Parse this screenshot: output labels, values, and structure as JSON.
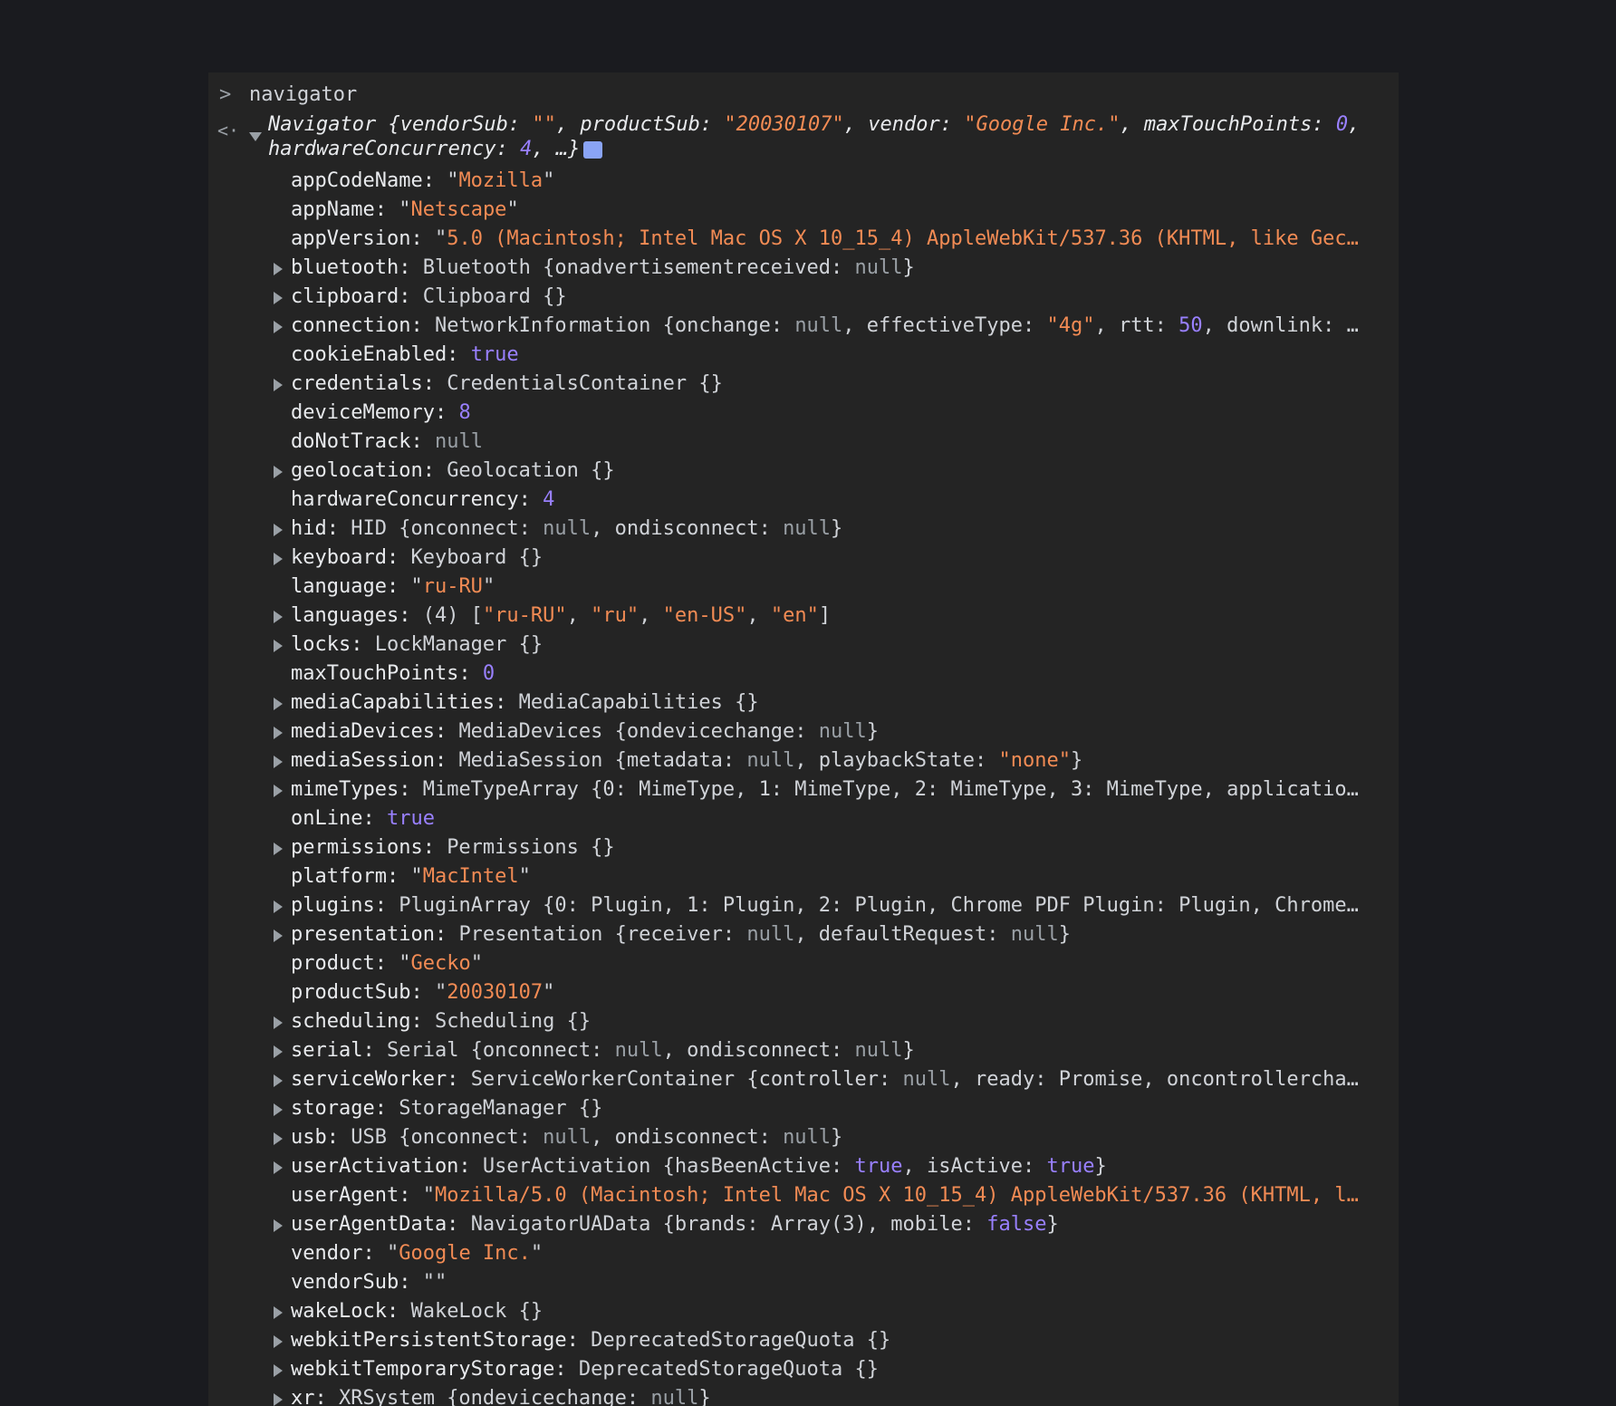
{
  "colors": {
    "page_bg": "#1a1b1f",
    "console_bg": "#242424",
    "string": "#f28b54",
    "number": "#9980ff",
    "null": "#9aa0a6",
    "text": "#e8eaed",
    "badge": "#8aa4f5"
  },
  "input": {
    "prompt_icon": "chevron-right-icon",
    "prompt_glyph": ">",
    "text": "navigator"
  },
  "result": {
    "return_icon": "return-arrow-icon",
    "return_glyph": "<·",
    "summary_line1": [
      {
        "c": "k",
        "v": "Navigator {vendorSub: "
      },
      {
        "c": "s",
        "v": "\"\""
      },
      {
        "c": "k",
        "v": ", productSub: "
      },
      {
        "c": "s",
        "v": "\"20030107\""
      },
      {
        "c": "k",
        "v": ", vendor: "
      },
      {
        "c": "s",
        "v": "\"Google Inc.\""
      },
      {
        "c": "k",
        "v": ", maxTouchPoints: "
      },
      {
        "c": "n",
        "v": "0"
      },
      {
        "c": "k",
        "v": ","
      }
    ],
    "summary_line2": [
      {
        "c": "k",
        "v": "hardwareConcurrency: "
      },
      {
        "c": "n",
        "v": "4"
      },
      {
        "c": "k",
        "v": ", …}"
      }
    ],
    "info_badge": "i"
  },
  "properties": [
    {
      "expandable": false,
      "parts": [
        {
          "c": "k",
          "v": "appCodeName: "
        },
        {
          "c": "t",
          "v": "\""
        },
        {
          "c": "s",
          "v": "Mozilla"
        },
        {
          "c": "t",
          "v": "\""
        }
      ]
    },
    {
      "expandable": false,
      "parts": [
        {
          "c": "k",
          "v": "appName: "
        },
        {
          "c": "t",
          "v": "\""
        },
        {
          "c": "s",
          "v": "Netscape"
        },
        {
          "c": "t",
          "v": "\""
        }
      ]
    },
    {
      "expandable": false,
      "parts": [
        {
          "c": "k",
          "v": "appVersion: "
        },
        {
          "c": "t",
          "v": "\""
        },
        {
          "c": "s",
          "v": "5.0 (Macintosh; Intel Mac OS X 10_15_4) AppleWebKit/537.36 (KHTML, like Gec…"
        }
      ]
    },
    {
      "expandable": true,
      "parts": [
        {
          "c": "k",
          "v": "bluetooth: "
        },
        {
          "c": "t",
          "v": "Bluetooth {onadvertisementreceived: "
        },
        {
          "c": "nl",
          "v": "null"
        },
        {
          "c": "t",
          "v": "}"
        }
      ]
    },
    {
      "expandable": true,
      "parts": [
        {
          "c": "k",
          "v": "clipboard: "
        },
        {
          "c": "t",
          "v": "Clipboard {}"
        }
      ]
    },
    {
      "expandable": true,
      "parts": [
        {
          "c": "k",
          "v": "connection: "
        },
        {
          "c": "t",
          "v": "NetworkInformation {onchange: "
        },
        {
          "c": "nl",
          "v": "null"
        },
        {
          "c": "t",
          "v": ", effectiveType: "
        },
        {
          "c": "s",
          "v": "\"4g\""
        },
        {
          "c": "t",
          "v": ", rtt: "
        },
        {
          "c": "n",
          "v": "50"
        },
        {
          "c": "t",
          "v": ", downlink: …"
        }
      ]
    },
    {
      "expandable": false,
      "parts": [
        {
          "c": "k",
          "v": "cookieEnabled: "
        },
        {
          "c": "b",
          "v": "true"
        }
      ]
    },
    {
      "expandable": true,
      "parts": [
        {
          "c": "k",
          "v": "credentials: "
        },
        {
          "c": "t",
          "v": "CredentialsContainer {}"
        }
      ]
    },
    {
      "expandable": false,
      "parts": [
        {
          "c": "k",
          "v": "deviceMemory: "
        },
        {
          "c": "n",
          "v": "8"
        }
      ]
    },
    {
      "expandable": false,
      "parts": [
        {
          "c": "k",
          "v": "doNotTrack: "
        },
        {
          "c": "nl",
          "v": "null"
        }
      ]
    },
    {
      "expandable": true,
      "parts": [
        {
          "c": "k",
          "v": "geolocation: "
        },
        {
          "c": "t",
          "v": "Geolocation {}"
        }
      ]
    },
    {
      "expandable": false,
      "parts": [
        {
          "c": "k",
          "v": "hardwareConcurrency: "
        },
        {
          "c": "n",
          "v": "4"
        }
      ]
    },
    {
      "expandable": true,
      "parts": [
        {
          "c": "k",
          "v": "hid: "
        },
        {
          "c": "t",
          "v": "HID {onconnect: "
        },
        {
          "c": "nl",
          "v": "null"
        },
        {
          "c": "t",
          "v": ", ondisconnect: "
        },
        {
          "c": "nl",
          "v": "null"
        },
        {
          "c": "t",
          "v": "}"
        }
      ]
    },
    {
      "expandable": true,
      "parts": [
        {
          "c": "k",
          "v": "keyboard: "
        },
        {
          "c": "t",
          "v": "Keyboard {}"
        }
      ]
    },
    {
      "expandable": false,
      "parts": [
        {
          "c": "k",
          "v": "language: "
        },
        {
          "c": "t",
          "v": "\""
        },
        {
          "c": "s",
          "v": "ru-RU"
        },
        {
          "c": "t",
          "v": "\""
        }
      ]
    },
    {
      "expandable": true,
      "parts": [
        {
          "c": "k",
          "v": "languages: "
        },
        {
          "c": "t",
          "v": "(4) ["
        },
        {
          "c": "s",
          "v": "\"ru-RU\""
        },
        {
          "c": "t",
          "v": ", "
        },
        {
          "c": "s",
          "v": "\"ru\""
        },
        {
          "c": "t",
          "v": ", "
        },
        {
          "c": "s",
          "v": "\"en-US\""
        },
        {
          "c": "t",
          "v": ", "
        },
        {
          "c": "s",
          "v": "\"en\""
        },
        {
          "c": "t",
          "v": "]"
        }
      ]
    },
    {
      "expandable": true,
      "parts": [
        {
          "c": "k",
          "v": "locks: "
        },
        {
          "c": "t",
          "v": "LockManager {}"
        }
      ]
    },
    {
      "expandable": false,
      "parts": [
        {
          "c": "k",
          "v": "maxTouchPoints: "
        },
        {
          "c": "n",
          "v": "0"
        }
      ]
    },
    {
      "expandable": true,
      "parts": [
        {
          "c": "k",
          "v": "mediaCapabilities: "
        },
        {
          "c": "t",
          "v": "MediaCapabilities {}"
        }
      ]
    },
    {
      "expandable": true,
      "parts": [
        {
          "c": "k",
          "v": "mediaDevices: "
        },
        {
          "c": "t",
          "v": "MediaDevices {ondevicechange: "
        },
        {
          "c": "nl",
          "v": "null"
        },
        {
          "c": "t",
          "v": "}"
        }
      ]
    },
    {
      "expandable": true,
      "parts": [
        {
          "c": "k",
          "v": "mediaSession: "
        },
        {
          "c": "t",
          "v": "MediaSession {metadata: "
        },
        {
          "c": "nl",
          "v": "null"
        },
        {
          "c": "t",
          "v": ", playbackState: "
        },
        {
          "c": "s",
          "v": "\"none\""
        },
        {
          "c": "t",
          "v": "}"
        }
      ]
    },
    {
      "expandable": true,
      "parts": [
        {
          "c": "k",
          "v": "mimeTypes: "
        },
        {
          "c": "t",
          "v": "MimeTypeArray {0: MimeType, 1: MimeType, 2: MimeType, 3: MimeType, applicatio…"
        }
      ]
    },
    {
      "expandable": false,
      "parts": [
        {
          "c": "k",
          "v": "onLine: "
        },
        {
          "c": "b",
          "v": "true"
        }
      ]
    },
    {
      "expandable": true,
      "parts": [
        {
          "c": "k",
          "v": "permissions: "
        },
        {
          "c": "t",
          "v": "Permissions {}"
        }
      ]
    },
    {
      "expandable": false,
      "parts": [
        {
          "c": "k",
          "v": "platform: "
        },
        {
          "c": "t",
          "v": "\""
        },
        {
          "c": "s",
          "v": "MacIntel"
        },
        {
          "c": "t",
          "v": "\""
        }
      ]
    },
    {
      "expandable": true,
      "parts": [
        {
          "c": "k",
          "v": "plugins: "
        },
        {
          "c": "t",
          "v": "PluginArray {0: Plugin, 1: Plugin, 2: Plugin, Chrome PDF Plugin: Plugin, Chrome…"
        }
      ]
    },
    {
      "expandable": true,
      "parts": [
        {
          "c": "k",
          "v": "presentation: "
        },
        {
          "c": "t",
          "v": "Presentation {receiver: "
        },
        {
          "c": "nl",
          "v": "null"
        },
        {
          "c": "t",
          "v": ", defaultRequest: "
        },
        {
          "c": "nl",
          "v": "null"
        },
        {
          "c": "t",
          "v": "}"
        }
      ]
    },
    {
      "expandable": false,
      "parts": [
        {
          "c": "k",
          "v": "product: "
        },
        {
          "c": "t",
          "v": "\""
        },
        {
          "c": "s",
          "v": "Gecko"
        },
        {
          "c": "t",
          "v": "\""
        }
      ]
    },
    {
      "expandable": false,
      "parts": [
        {
          "c": "k",
          "v": "productSub: "
        },
        {
          "c": "t",
          "v": "\""
        },
        {
          "c": "s",
          "v": "20030107"
        },
        {
          "c": "t",
          "v": "\""
        }
      ]
    },
    {
      "expandable": true,
      "parts": [
        {
          "c": "k",
          "v": "scheduling: "
        },
        {
          "c": "t",
          "v": "Scheduling {}"
        }
      ]
    },
    {
      "expandable": true,
      "parts": [
        {
          "c": "k",
          "v": "serial: "
        },
        {
          "c": "t",
          "v": "Serial {onconnect: "
        },
        {
          "c": "nl",
          "v": "null"
        },
        {
          "c": "t",
          "v": ", ondisconnect: "
        },
        {
          "c": "nl",
          "v": "null"
        },
        {
          "c": "t",
          "v": "}"
        }
      ]
    },
    {
      "expandable": true,
      "parts": [
        {
          "c": "k",
          "v": "serviceWorker: "
        },
        {
          "c": "t",
          "v": "ServiceWorkerContainer {controller: "
        },
        {
          "c": "nl",
          "v": "null"
        },
        {
          "c": "t",
          "v": ", ready: Promise, oncontrollercha…"
        }
      ]
    },
    {
      "expandable": true,
      "parts": [
        {
          "c": "k",
          "v": "storage: "
        },
        {
          "c": "t",
          "v": "StorageManager {}"
        }
      ]
    },
    {
      "expandable": true,
      "parts": [
        {
          "c": "k",
          "v": "usb: "
        },
        {
          "c": "t",
          "v": "USB {onconnect: "
        },
        {
          "c": "nl",
          "v": "null"
        },
        {
          "c": "t",
          "v": ", ondisconnect: "
        },
        {
          "c": "nl",
          "v": "null"
        },
        {
          "c": "t",
          "v": "}"
        }
      ]
    },
    {
      "expandable": true,
      "parts": [
        {
          "c": "k",
          "v": "userActivation: "
        },
        {
          "c": "t",
          "v": "UserActivation {hasBeenActive: "
        },
        {
          "c": "b",
          "v": "true"
        },
        {
          "c": "t",
          "v": ", isActive: "
        },
        {
          "c": "b",
          "v": "true"
        },
        {
          "c": "t",
          "v": "}"
        }
      ]
    },
    {
      "expandable": false,
      "parts": [
        {
          "c": "k",
          "v": "userAgent: "
        },
        {
          "c": "t",
          "v": "\""
        },
        {
          "c": "s",
          "v": "Mozilla/5.0 (Macintosh; Intel Mac OS X 10_15_4) AppleWebKit/537.36 (KHTML, l…"
        }
      ]
    },
    {
      "expandable": true,
      "parts": [
        {
          "c": "k",
          "v": "userAgentData: "
        },
        {
          "c": "t",
          "v": "NavigatorUAData {brands: Array(3), mobile: "
        },
        {
          "c": "b",
          "v": "false"
        },
        {
          "c": "t",
          "v": "}"
        }
      ]
    },
    {
      "expandable": false,
      "parts": [
        {
          "c": "k",
          "v": "vendor: "
        },
        {
          "c": "t",
          "v": "\""
        },
        {
          "c": "s",
          "v": "Google Inc."
        },
        {
          "c": "t",
          "v": "\""
        }
      ]
    },
    {
      "expandable": false,
      "parts": [
        {
          "c": "k",
          "v": "vendorSub: "
        },
        {
          "c": "t",
          "v": "\"\""
        }
      ]
    },
    {
      "expandable": true,
      "parts": [
        {
          "c": "k",
          "v": "wakeLock: "
        },
        {
          "c": "t",
          "v": "WakeLock {}"
        }
      ]
    },
    {
      "expandable": true,
      "parts": [
        {
          "c": "k",
          "v": "webkitPersistentStorage: "
        },
        {
          "c": "t",
          "v": "DeprecatedStorageQuota {}"
        }
      ]
    },
    {
      "expandable": true,
      "parts": [
        {
          "c": "k",
          "v": "webkitTemporaryStorage: "
        },
        {
          "c": "t",
          "v": "DeprecatedStorageQuota {}"
        }
      ]
    },
    {
      "expandable": true,
      "parts": [
        {
          "c": "k",
          "v": "xr: "
        },
        {
          "c": "t",
          "v": "XRSystem {ondevicechange: "
        },
        {
          "c": "nl",
          "v": "null"
        },
        {
          "c": "t",
          "v": "}"
        }
      ]
    }
  ]
}
